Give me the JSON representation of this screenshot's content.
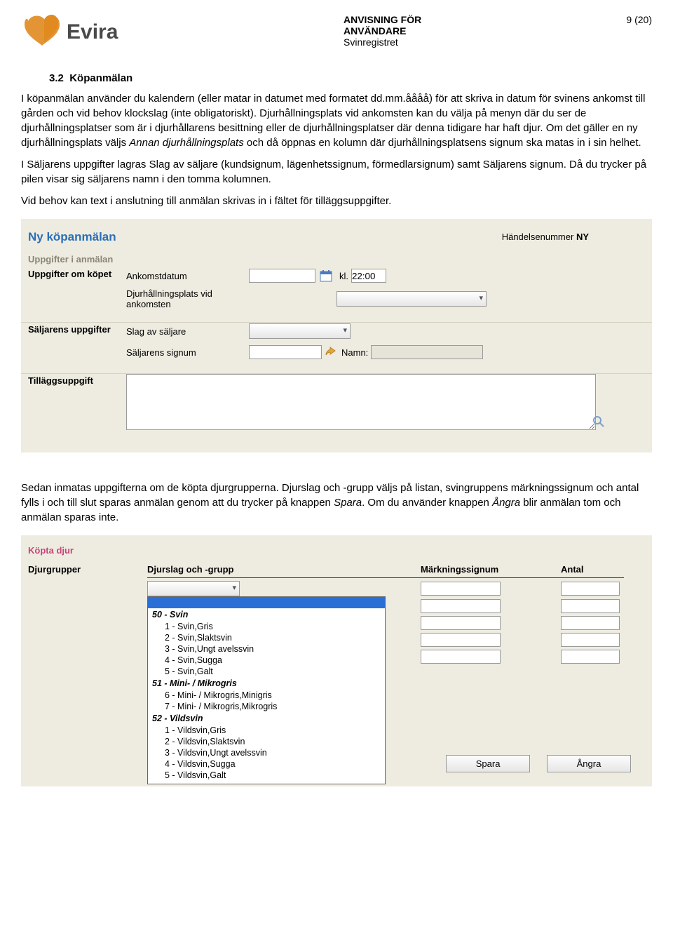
{
  "header": {
    "title_line1": "ANVISNING FÖR",
    "title_line2": "ANVÄNDARE",
    "subtitle": "Svinregistret",
    "page_number": "9 (20)"
  },
  "logo_name": "Evira",
  "section": {
    "number": "3.2",
    "title": "Köpanmälan"
  },
  "para1": "I köpanmälan använder du kalendern (eller matar in datumet med formatet dd.mm.åååå) för att skriva in datum för svinens ankomst till gården och vid behov klockslag (inte obligatoriskt). Djurhållningsplats vid ankomsten kan du välja på menyn där du ser de djurhållningsplatser som är i djurhållarens besittning eller de djurhållningsplatser där denna tidigare har haft djur. Om det gäller en ny djurhållningsplats väljs ",
  "para1_it1": "Annan djurhållningsplats",
  "para1_cont": " och då öppnas en kolumn där djurhållningsplatsens signum ska matas in i sin helhet.",
  "para2": "I Säljarens uppgifter lagras Slag av säljare (kundsignum, lägenhetssignum, förmedlarsignum) samt Säljarens signum. Då du trycker på pilen visar sig säljarens namn i den tomma kolumnen.",
  "para3": "Vid behov kan text i anslutning till anmälan skrivas in i fältet för tilläggsuppgifter.",
  "form1": {
    "title": "Ny köpanmälan",
    "event_label": "Händelsenummer",
    "event_value": "NY",
    "sub_head": "Uppgifter i anmälan",
    "sect1_label": "Uppgifter om köpet",
    "sect1_f1": "Ankomstdatum",
    "sect1_kl": "kl.",
    "sect1_time": "22:00",
    "sect1_f2": "Djurhållningsplats vid ankomsten",
    "sect2_label": "Säljarens uppgifter",
    "sect2_f1": "Slag av säljare",
    "sect2_f2": "Säljarens signum",
    "sect2_namn": "Namn:",
    "sect3_label": "Tilläggsuppgift"
  },
  "para4a": "Sedan inmatas uppgifterna om de köpta djurgrupperna. Djurslag och -grupp väljs på listan, svingruppens märkningssignum och antal fylls i och till slut sparas anmälan genom att du trycker på knappen ",
  "para4_it1": "Spara",
  "para4b": ". Om du använder knappen ",
  "para4_it2": "Ångra",
  "para4c": " blir anmälan tom och anmälan sparas inte.",
  "form2": {
    "title": "Köpta djur",
    "row_label": "Djurgrupper",
    "col_b": "Djurslag och -grupp",
    "col_c": "Märkningssignum",
    "col_d": "Antal",
    "dropdown": {
      "groups": [
        {
          "head": "50 - Svin",
          "items": [
            "1 - Svin,Gris",
            "2 - Svin,Slaktsvin",
            "3 - Svin,Ungt avelssvin",
            "4 - Svin,Sugga",
            "5 - Svin,Galt"
          ]
        },
        {
          "head": "51 - Mini- / Mikrogris",
          "items": [
            "6 - Mini- / Mikrogris,Minigris",
            "7 - Mini- / Mikrogris,Mikrogris"
          ]
        },
        {
          "head": "52 - Vildsvin",
          "items": [
            "1 - Vildsvin,Gris",
            "2 - Vildsvin,Slaktsvin",
            "3 - Vildsvin,Ungt avelssvin",
            "4 - Vildsvin,Sugga",
            "5 - Vildsvin,Galt"
          ]
        }
      ]
    },
    "btn_save": "Spara",
    "btn_cancel": "Ångra"
  }
}
